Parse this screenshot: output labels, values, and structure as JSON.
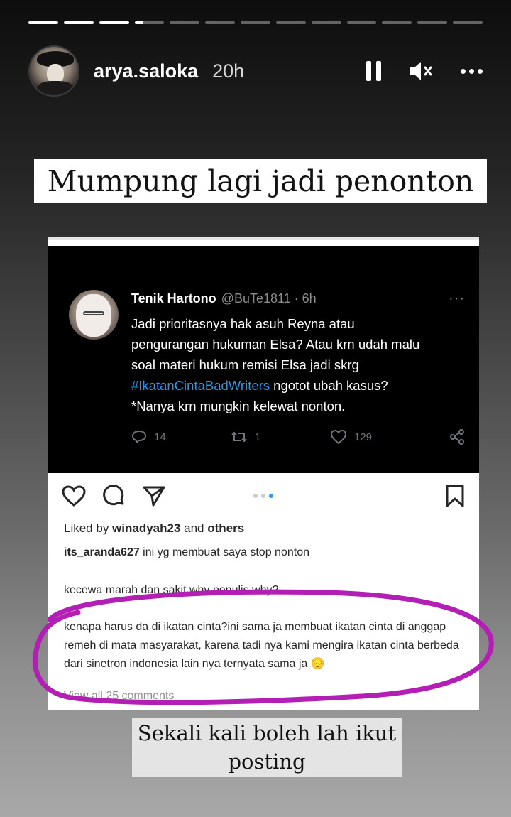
{
  "story": {
    "progress_segments": [
      1,
      1,
      1,
      0.3,
      0,
      0,
      0,
      0,
      0,
      0,
      0,
      0,
      0
    ],
    "username": "arya.saloka",
    "time": "20h"
  },
  "caption_top": "Mumpung lagi jadi penonton",
  "tweet": {
    "name": "Tenik Hartono",
    "handle": "@BuTe1811 · 6h",
    "more": "···",
    "text_lines": [
      "Jadi prioritasnya hak asuh Reyna atau",
      "pengurangan hukuman Elsa? Atau krn udah malu",
      "soal materi hukum remisi Elsa jadi skrg"
    ],
    "hashtag": "#IkatanCintaBadWriters",
    "text_after_hashtag": " ngotot ubah kasus?",
    "text_last_line": "*Nanya krn mungkin kelewat nonton.",
    "replies": "14",
    "retweets": "1",
    "likes": "129"
  },
  "post": {
    "liked_by_prefix": "Liked by ",
    "liked_by_user": "winadyah23",
    "liked_by_and": " and ",
    "liked_by_others": "others",
    "comments": [
      {
        "user": "its_aranda627",
        "text": " ini yg membuat saya stop nonton"
      },
      {
        "user": "",
        "text": "kecewa marah dan sakit why penulis why?"
      },
      {
        "user": "",
        "text": "kenapa harus da di ikatan cinta?ini sama ja membuat ikatan cinta di anggap remeh di mata masyarakat, karena tadi nya kami mengira ikatan cinta berbeda dari sinetron indonesia lain nya ternyata sama ja 😔"
      }
    ],
    "view_all": "View all 25 comments"
  },
  "caption_bottom": "Sekali kali boleh lah ikut posting",
  "colors": {
    "annotation": "#b31fb5",
    "hashtag": "#1d9bf0",
    "tweet_bg": "#000000"
  }
}
